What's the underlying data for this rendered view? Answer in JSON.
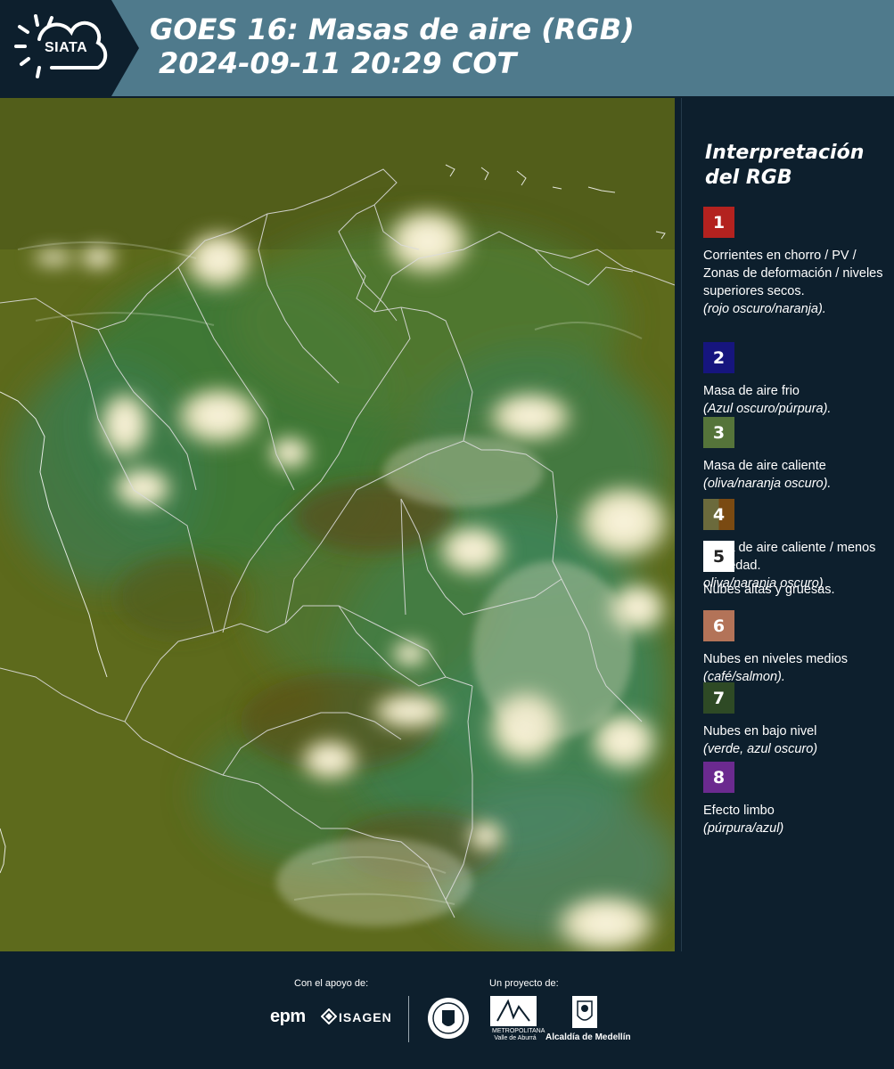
{
  "header": {
    "logo_text": "SIATA",
    "title_line1": "GOES 16: Masas de aire (RGB)",
    "title_line2": "2024-09-11 20:29 COT"
  },
  "colors": {
    "header_bg": "#4f7a8c",
    "panel_bg": "#0d1f2d",
    "map_base": "#5d6a1c"
  },
  "legend": {
    "title_line1": "Interpretación",
    "title_line2": "del RGB",
    "items": [
      {
        "number": "1",
        "color": "#b3221f",
        "color2": "",
        "text": "Corrientes en chorro / PV / Zonas de deformación / niveles superiores secos.",
        "note": "(rojo oscuro/naranja)."
      },
      {
        "number": "2",
        "color": "#16157e",
        "color2": "",
        "text": "Masa de aire frio",
        "note": "(Azul oscuro/púrpura)."
      },
      {
        "number": "3",
        "color": "#55743a",
        "color2": "",
        "text": "Masa de aire caliente",
        "note": "(oliva/naranja oscuro)."
      },
      {
        "number": "4",
        "color": "#6b6a3c",
        "color2": "#7a4a12",
        "text": "Masa de aire caliente / menos humedad.",
        "note": "oliva/naranja oscuro)"
      },
      {
        "number": "5",
        "color": "#ffffff",
        "color2": "",
        "text": "Nubes altas y gruesas.",
        "note": ""
      },
      {
        "number": "6",
        "color": "#b37358",
        "color2": "",
        "text": "Nubes en niveles medios",
        "note": "(café/salmon)."
      },
      {
        "number": "7",
        "color": "#2e4a25",
        "color2": "",
        "text": "Nubes en bajo nivel",
        "note": "(verde, azul oscuro)"
      },
      {
        "number": "8",
        "color": "#6b2a8f",
        "color2": "",
        "text": "Efecto limbo",
        "note": "(púrpura/azul)"
      }
    ]
  },
  "footer": {
    "support_label": "Con el apoyo de:",
    "project_label": "Un proyecto de:",
    "sponsor1": "epm",
    "sponsor2": "ISAGEN",
    "metro_label": "METROPOLITANA Valle de Aburrá",
    "alcaldia_label": "Alcaldía de Medellín"
  }
}
